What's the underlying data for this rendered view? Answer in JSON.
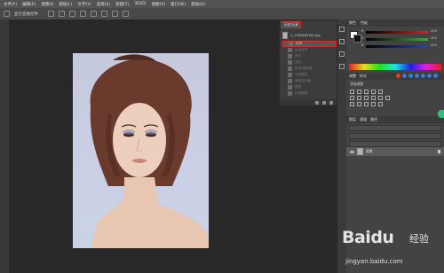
{
  "menubar": {
    "items": [
      "文件(F)",
      "编辑(E)",
      "图像(I)",
      "图层(L)",
      "文字(Y)",
      "选择(S)",
      "滤镜(T)",
      "3D(D)",
      "视图(V)",
      "窗口(W)",
      "帮助(H)"
    ]
  },
  "options": {
    "label": "显示变换控件"
  },
  "history": {
    "tab_label": "历史记录",
    "document": "u_1165480182.jpg",
    "items": [
      "打开",
      "自由变换",
      "色阶",
      "曲线",
      "色相/饱和度",
      "可选颜色",
      "通道混合器",
      "图层",
      "仿制图章"
    ]
  },
  "color_panel": {
    "tab_color": "颜色",
    "tab_swatches": "色板",
    "slider_r": "R",
    "slider_g": "G",
    "slider_b": "B",
    "value_r": "255",
    "value_g": "255",
    "value_b": "255"
  },
  "adjustments": {
    "tab": "调整",
    "tab2": "样式",
    "title": "添加调整"
  },
  "layers": {
    "tab": "图层",
    "tab2": "通道",
    "tab3": "路径",
    "layer_name": "背景"
  },
  "watermark": {
    "logo": "Baidu",
    "jingyan": "经验",
    "url": "jingyan.baidu.com"
  }
}
